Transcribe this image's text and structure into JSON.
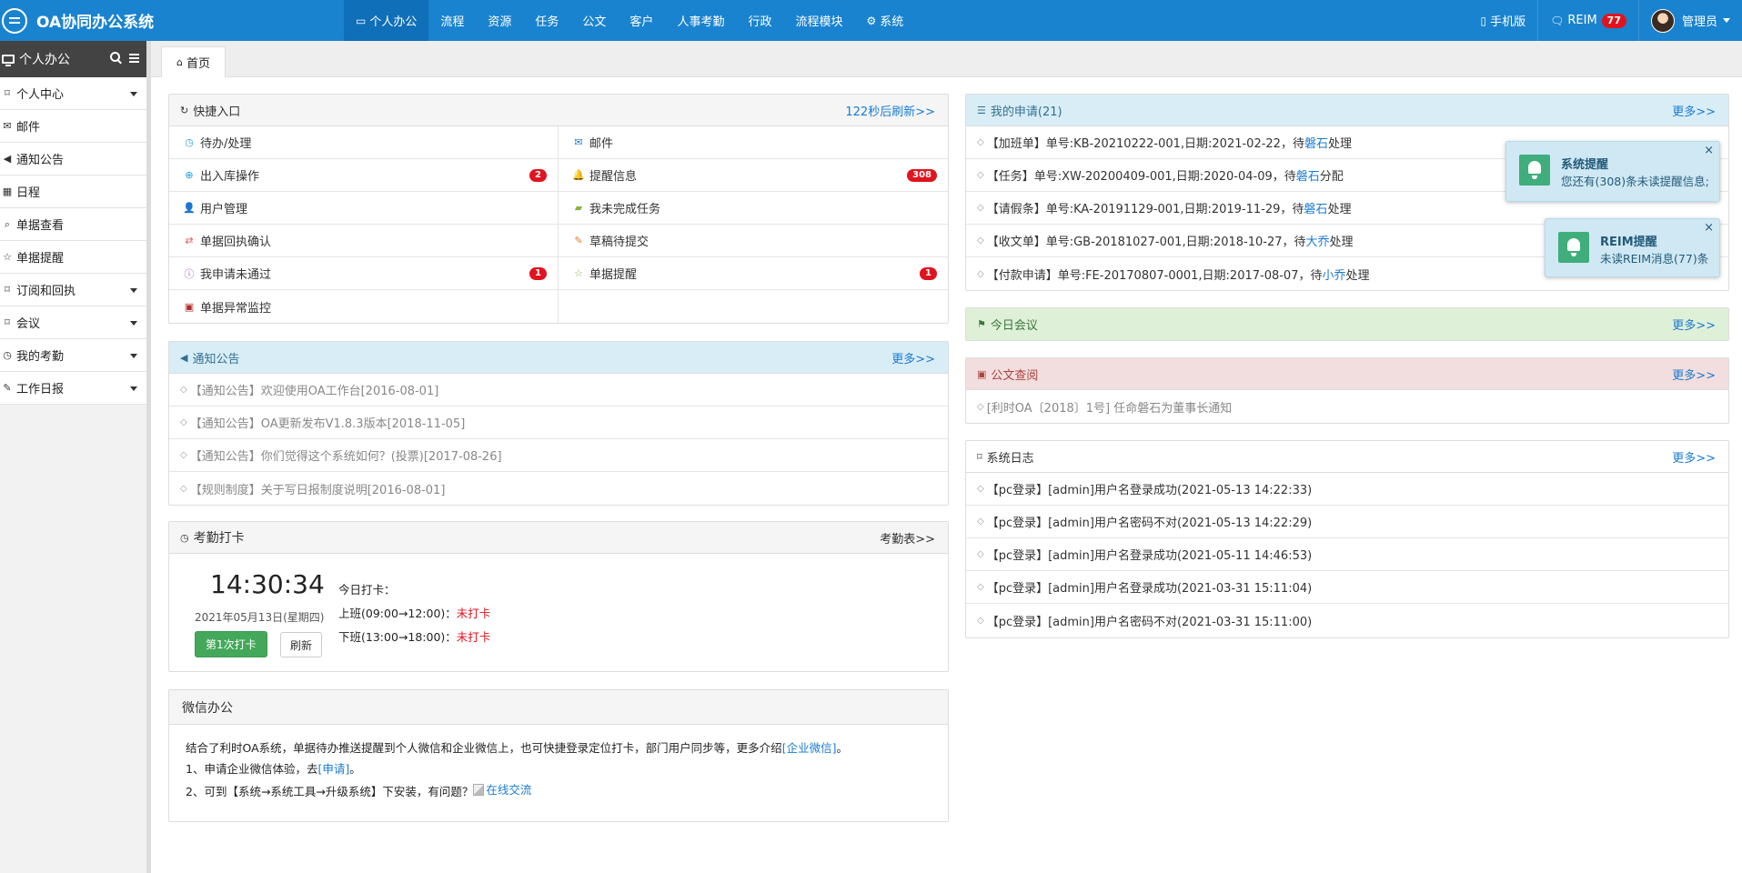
{
  "app": {
    "title": "OA协同办公系统"
  },
  "topnav": {
    "items": [
      {
        "label": "个人办公",
        "icon": "monitor-icon",
        "active": true
      },
      {
        "label": "流程"
      },
      {
        "label": "资源"
      },
      {
        "label": "任务"
      },
      {
        "label": "公文"
      },
      {
        "label": "客户"
      },
      {
        "label": "人事考勤"
      },
      {
        "label": "行政"
      },
      {
        "label": "流程模块"
      },
      {
        "label": "系统",
        "icon": "gear-icon"
      }
    ],
    "mobile_label": "手机版",
    "reim_label": "REIM",
    "reim_count": "77",
    "user_label": "管理员"
  },
  "sidebar": {
    "title": "个人办公",
    "items": [
      {
        "label": "个人中心",
        "icon": "bookmark-icon",
        "caret": true
      },
      {
        "label": "邮件",
        "icon": "envelope-icon"
      },
      {
        "label": "通知公告",
        "icon": "volume-icon"
      },
      {
        "label": "日程",
        "icon": "calendar-icon"
      },
      {
        "label": "单据查看",
        "icon": "search-icon"
      },
      {
        "label": "单据提醒",
        "icon": "star-icon"
      },
      {
        "label": "订阅和回执",
        "icon": "bookmark-icon",
        "caret": true
      },
      {
        "label": "会议",
        "icon": "bookmark-icon",
        "caret": true
      },
      {
        "label": "我的考勤",
        "icon": "clock-icon",
        "caret": true
      },
      {
        "label": "工作日报",
        "icon": "edit-icon",
        "caret": true
      }
    ]
  },
  "tabs": {
    "home": "首页"
  },
  "quick": {
    "title": "快捷入口",
    "refresh": "122秒后刷新>>",
    "cells": [
      {
        "label": "待办/处理",
        "badge": ""
      },
      {
        "label": "邮件",
        "badge": ""
      },
      {
        "label": "出入库操作",
        "badge": "2"
      },
      {
        "label": "提醒信息",
        "badge": "308"
      },
      {
        "label": "用户管理",
        "badge": ""
      },
      {
        "label": "我未完成任务",
        "badge": ""
      },
      {
        "label": "单据回执确认",
        "badge": ""
      },
      {
        "label": "草稿待提交",
        "badge": ""
      },
      {
        "label": "我申请未通过",
        "badge": "1"
      },
      {
        "label": "单据提醒",
        "badge": "1"
      },
      {
        "label": "单据异常监控",
        "badge": ""
      },
      {
        "label": "",
        "badge": ""
      }
    ]
  },
  "notice": {
    "title": "通知公告",
    "more": "更多>>",
    "items": [
      "【通知公告】欢迎使用OA工作台[2016-08-01]",
      "【通知公告】OA更新发布V1.8.3版本[2018-11-05]",
      "【通知公告】你们觉得这个系统如何？(投票)[2017-08-26]",
      "【规则制度】关于写日报制度说明[2016-08-01]"
    ]
  },
  "attendance": {
    "title": "考勤打卡",
    "link": "考勤表>>",
    "time": "14:30:34",
    "date": "2021年05月13日(星期四)",
    "punch_button": "第1次打卡",
    "refresh_button": "刷新",
    "today_label": "今日打卡：",
    "am_label": "上班(09:00→12:00)：",
    "am_status": "未打卡",
    "pm_label": "下班(13:00→18:00)：",
    "pm_status": "未打卡"
  },
  "wechat": {
    "title": "微信办公",
    "line1_prefix": "结合了利时OA系统，单据待办推送提醒到个人微信和企业微信上，也可快捷登录定位打卡，部门用户同步等，更多介绍",
    "line1_link": "[企业微信]",
    "line1_suffix": "。",
    "line2_prefix": "1、申请企业微信体验，去",
    "line2_link": "[申请]",
    "line2_suffix": "。",
    "line3_prefix": "2、可到【系统→系统工具→升级系统】下安装，有问题？",
    "line3_link": "在线交流"
  },
  "myapply": {
    "title": "我的申请(21)",
    "more": "更多>>",
    "items": [
      {
        "pre": "【加班单】单号:KB-20210222-001,日期:2021-02-22，待",
        "who": "磐石",
        "post": "处理"
      },
      {
        "pre": "【任务】单号:XW-20200409-001,日期:2020-04-09，待",
        "who": "磐石",
        "post": "分配"
      },
      {
        "pre": "【请假条】单号:KA-20191129-001,日期:2019-11-29，待",
        "who": "磐石",
        "post": "处理"
      },
      {
        "pre": "【收文单】单号:GB-20181027-001,日期:2018-10-27，待",
        "who": "大乔",
        "post": "处理"
      },
      {
        "pre": "【付款申请】单号:FE-20170807-0001,日期:2017-08-07，待",
        "who": "小乔",
        "post": "处理"
      }
    ]
  },
  "meeting": {
    "title": "今日会议",
    "more": "更多>>"
  },
  "docs": {
    "title": "公文查阅",
    "more": "更多>>",
    "items": [
      "[利时OA〔2018〕1号] 任命磐石为董事长通知"
    ]
  },
  "syslog": {
    "title": "系统日志",
    "more": "更多>>",
    "items": [
      "【pc登录】[admin]用户名登录成功(2021-05-13 14:22:33)",
      "【pc登录】[admin]用户名密码不对(2021-05-13 14:22:29)",
      "【pc登录】[admin]用户名登录成功(2021-05-11 14:46:53)",
      "【pc登录】[admin]用户名登录成功(2021-03-31 15:11:04)",
      "【pc登录】[admin]用户名密码不对(2021-03-31 15:11:00)"
    ]
  },
  "toasts": [
    {
      "title": "系统提醒",
      "message": "您还有(308)条未读提醒信息;"
    },
    {
      "title": "REIM提醒",
      "message": "未读REIM消息(77)条"
    }
  ],
  "colors": {
    "navbar": "#1a83cf",
    "badge": "#e0141f",
    "success_button": "#43a85a",
    "link": "#1a7bd0"
  }
}
